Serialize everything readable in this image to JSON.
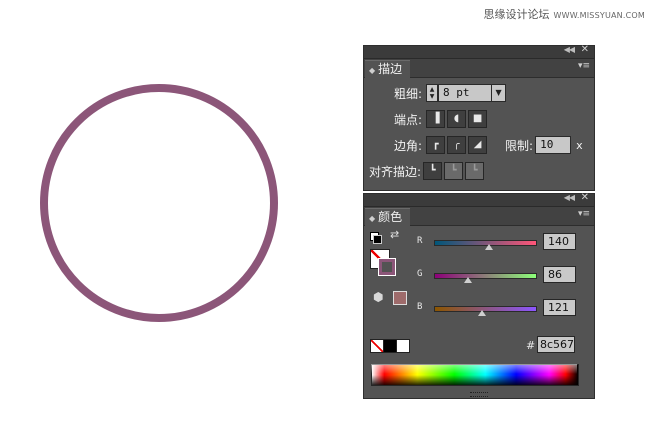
{
  "watermark": {
    "text": "思缘设计论坛",
    "url": "WWW.MISSYUAN.COM"
  },
  "artwork": {
    "stroke_color": "#8c5679"
  },
  "stroke_panel": {
    "collapse_icon": "double-chevron-left-icon",
    "close_icon": "close-icon",
    "tab_label": "描边",
    "menu_icon": "panel-menu-icon",
    "weight_label": "粗细:",
    "weight_value": "8 pt",
    "cap_label": "端点:",
    "corner_label": "边角:",
    "limit_label": "限制:",
    "limit_value": "10",
    "limit_unit": "x",
    "align_label": "对齐描边:"
  },
  "color_panel": {
    "collapse_icon": "double-chevron-left-icon",
    "close_icon": "close-icon",
    "tab_label": "颜色",
    "menu_icon": "panel-menu-icon",
    "channels": [
      {
        "label": "R",
        "value": "140",
        "fraction": 0.549
      },
      {
        "label": "G",
        "value": "86",
        "fraction": 0.337
      },
      {
        "label": "B",
        "value": "121",
        "fraction": 0.475
      }
    ],
    "hash_label": "#",
    "hex_value": "8c5679",
    "stroke_swatch_color": "#8c5679",
    "out_of_gamut_color": "#9e6b6b"
  }
}
